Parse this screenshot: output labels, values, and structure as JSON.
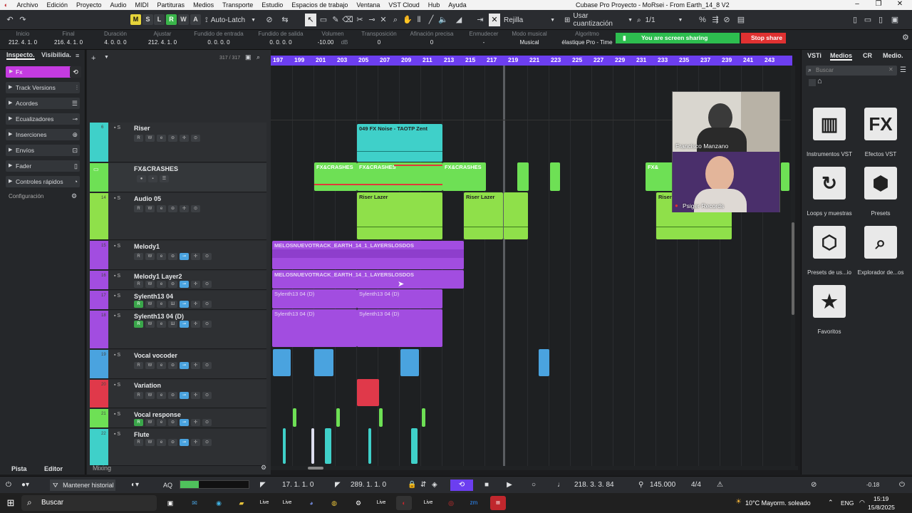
{
  "menu": {
    "items": [
      "Archivo",
      "Edición",
      "Proyecto",
      "Audio",
      "MIDI",
      "Partituras",
      "Medios",
      "Transporte",
      "Estudio",
      "Espacios de trabajo",
      "Ventana",
      "VST Cloud",
      "Hub",
      "Ayuda"
    ],
    "title": "Cubase Pro Proyecto - MoRsei - From Earth_14_8 V2"
  },
  "toolbar": {
    "modes": [
      "M",
      "S",
      "L",
      "R",
      "W",
      "A"
    ],
    "autolatch": "Auto-Latch",
    "grid": "Rejilla",
    "quantize": "Usar cuantización",
    "quant_value": "1/1"
  },
  "info": [
    {
      "label": "Inicio",
      "value": "212. 4. 1.   0"
    },
    {
      "label": "Final",
      "value": "216. 4. 1.   0"
    },
    {
      "label": "Duración",
      "value": "4. 0. 0.   0"
    },
    {
      "label": "Ajustar",
      "value": "212. 4. 1.   0"
    },
    {
      "label": "Fundido de entrada",
      "value": "0. 0. 0.   0"
    },
    {
      "label": "Fundido de salida",
      "value": "0. 0. 0.   0"
    },
    {
      "label": "Volumen",
      "value": "-10.00"
    },
    {
      "label": "Transposición",
      "value": "0"
    },
    {
      "label": "Afinación precisa",
      "value": "0"
    },
    {
      "label": "Enmudecer",
      "value": "-"
    },
    {
      "label": "Modo musical",
      "value": "Musical"
    },
    {
      "label": "Algoritmo",
      "value": "élastique Pro - Time"
    }
  ],
  "info_db": "dB",
  "share": {
    "sharing": "You are screen sharing",
    "stop": "Stop share"
  },
  "inspector": {
    "tab1": "Inspecto.",
    "tab2": "Visibilida.",
    "fx": "Fx",
    "sections": [
      "Track Versions",
      "Acordes",
      "Ecualizadores",
      "Inserciones",
      "Envíos",
      "Fader",
      "Controles rápidos"
    ],
    "config": "Configuración",
    "bottom_tabs": [
      "Pista",
      "Editor"
    ]
  },
  "tracklist": {
    "count": "317 / 317",
    "tracks": [
      {
        "name": "Riser",
        "color": "#3fd0c9",
        "num": "6"
      },
      {
        "name": "FX&CRASHES",
        "color": "#6ee055",
        "num": ""
      },
      {
        "name": "Audio 05",
        "color": "#8fe04a",
        "num": "14"
      },
      {
        "name": "Melody1",
        "color": "#a24de0",
        "num": "15"
      },
      {
        "name": "Melody1 Layer2",
        "color": "#a24de0",
        "num": "16"
      },
      {
        "name": "Sylenth13 04",
        "color": "#a24de0",
        "num": "17"
      },
      {
        "name": "Sylenth13 04 (D)",
        "color": "#a24de0",
        "num": "18"
      },
      {
        "name": "Vocal vocoder",
        "color": "#4aa3df",
        "num": "19"
      },
      {
        "name": "Variation",
        "color": "#e0394a",
        "num": "20"
      },
      {
        "name": "Vocal response",
        "color": "#6ee055",
        "num": "21"
      },
      {
        "name": "Flute",
        "color": "#3fd0c9",
        "num": "22"
      }
    ],
    "mixing": "Mixing"
  },
  "ruler": [
    "197",
    "199",
    "201",
    "203",
    "205",
    "207",
    "209",
    "211",
    "213",
    "215",
    "217",
    "219",
    "221",
    "223",
    "225",
    "227",
    "229",
    "231",
    "233",
    "235",
    "237",
    "239",
    "241",
    "243"
  ],
  "events": {
    "riser": "049 FX Noise - TAOTP Zent",
    "fx1": "FX&CRASHES",
    "fx2": "FX&CRASHES",
    "fx3": "FX&CRASHES",
    "fx4": "FX&",
    "lazer1": "Riser Lazer",
    "lazer2": "Riser Lazer",
    "lazer3": "Riser",
    "melody": "MELOSNUEVOTRACK_EARTH_14_1_LAYERSLOSDOS",
    "melody2": "MELOSNUEVOTRACK_EARTH_14_1_LAYERSLOSDOS",
    "syl1": "Sylenth13 04 (D)",
    "syl2": "Sylenth13 04 (D)",
    "syl3": "Sylenth13 04 (D)",
    "syl4": "Sylenth13 04 (D)"
  },
  "video": {
    "p1": "Francisco Manzano",
    "p2": "Psiger Records"
  },
  "rightpanel": {
    "tabs": [
      "VSTi",
      "Medios",
      "CR",
      "Medio."
    ],
    "search": "Buscar",
    "tiles": [
      "Instrumentos VST",
      "Efectos VST",
      "Loops y muestras",
      "Presets",
      "Presets de us...io",
      "Explorador de...os",
      "Favoritos"
    ]
  },
  "transport": {
    "history": "Mantener historial",
    "aq": "AQ",
    "left_loc": "17. 1. 1.   0",
    "right_loc": "289. 1. 1.   0",
    "position": "218. 3. 3. 84",
    "tempo": "145.000",
    "signature": "4/4",
    "level": "-0.18"
  },
  "taskbar": {
    "search": "Buscar",
    "weather": "10°C  Mayorm. soleado",
    "lang": "ENG",
    "time": "15:19",
    "date": "15/8/2025"
  }
}
